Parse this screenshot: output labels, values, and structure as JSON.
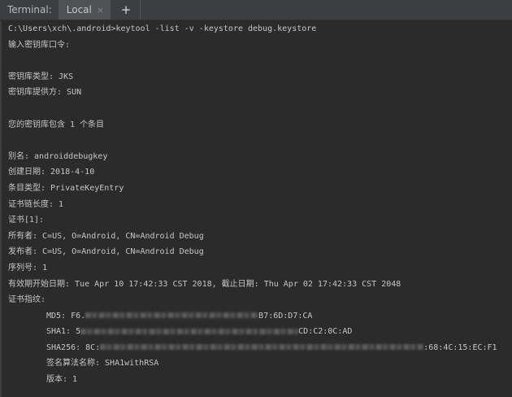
{
  "tabbar": {
    "title": "Terminal:",
    "tab_label": "Local",
    "close_glyph": "×",
    "add_glyph": "+"
  },
  "lines": [
    "C:\\Users\\xch\\.android>keytool -list -v -keystore debug.keystore",
    "输入密钥库口令:",
    "",
    "密钥库类型: JKS",
    "密钥库提供方: SUN",
    "",
    "您的密钥库包含 1 个条目",
    "",
    "别名: androiddebugkey",
    "创建日期: 2018-4-10",
    "条目类型: PrivateKeyEntry",
    "证书链长度: 1",
    "证书[1]:",
    "所有者: C=US, O=Android, CN=Android Debug",
    "发布者: C=US, O=Android, CN=Android Debug",
    "序列号: 1",
    "有效期开始日期: Tue Apr 10 17:42:33 CST 2018, 截止日期: Thu Apr 02 17:42:33 CST 2048",
    "证书指纹:"
  ],
  "fingerprints": [
    {
      "prefix": "MD5: F6.",
      "suffix": "B7:6D:D7:CA"
    },
    {
      "prefix": "SHA1: 5",
      "suffix": "CD:C2:0C:AD"
    },
    {
      "prefix": "SHA256: 8C:",
      "suffix": ":68:4C:15:EC:F1"
    }
  ],
  "tail": [
    "签名算法名称: SHA1withRSA",
    "版本: 1"
  ]
}
